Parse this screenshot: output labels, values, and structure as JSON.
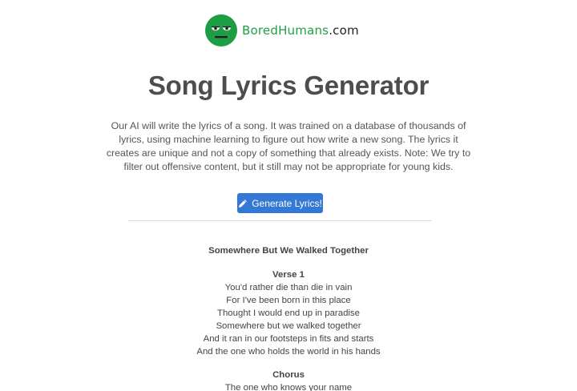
{
  "logo": {
    "text_bored": "Bored",
    "text_humans": "Humans",
    "text_domain": ".com",
    "icon": "bored-face-icon",
    "color": "#1e9e44"
  },
  "title": "Song Lyrics Generator",
  "description": "Our AI will write the lyrics of a song. It was trained on a database of thousands of lyrics, using machine learning to figure out how write a new song. The lyrics it creates are unique and not a copy of something that already exists. Note: We try to filter out offensive content, but it still may not be appropriate for young kids.",
  "generate_button": {
    "label": "Generate Lyrics!",
    "icon": "pencil-icon",
    "color": "#3478d6"
  },
  "song": {
    "title": "Somewhere But We Walked Together",
    "verse1": {
      "heading": "Verse 1",
      "lines": [
        "You'd rather die than die in vain",
        "For I've been born in this place",
        "Thought I would end up in paradise",
        "Somewhere but we walked together",
        "And it ran in our footsteps in fits and starts",
        "And the one who holds the world in his hands"
      ]
    },
    "chorus": {
      "heading": "Chorus",
      "lines": [
        "The one who knows your name"
      ]
    }
  }
}
